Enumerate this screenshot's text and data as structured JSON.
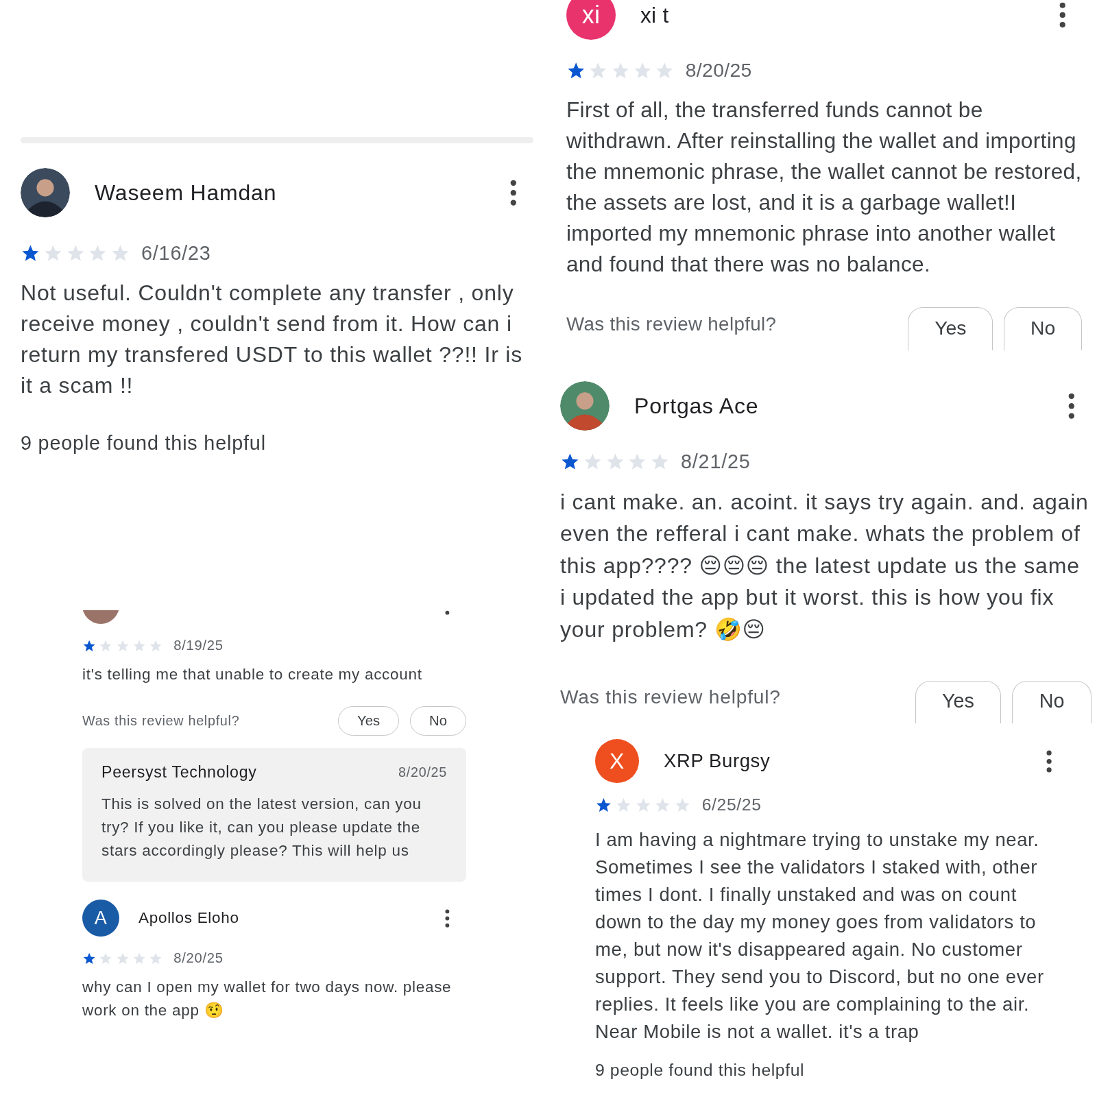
{
  "panels": [
    {
      "reviews": [
        {
          "avatar": {
            "kind": "photo"
          },
          "name": "Waseem Hamdan",
          "stars": 1,
          "date": "6/16/23",
          "text": "Not useful. Couldn't complete any transfer , only receive money , couldn't send from it. How can i return my transfered USDT to this wallet ??!! Ir is it a scam !!",
          "helpful_count": "9 people found this helpful"
        }
      ]
    },
    {
      "reviews": [
        {
          "avatar": {
            "kind": "letter",
            "letter": "xi",
            "color": "#e8336d"
          },
          "name": "xi t",
          "stars": 1,
          "date": "8/20/25",
          "text": "First of all, the transferred funds cannot be withdrawn. After reinstalling the wallet and importing the mnemonic phrase, the wallet cannot be restored, the assets are lost, and it is a garbage wallet!I imported my mnemonic phrase into another wallet and found that there was no balance.",
          "helpful_prompt": "Was this review helpful?",
          "buttons": [
            "Yes",
            "No"
          ]
        }
      ]
    },
    {
      "reviews": [
        {
          "avatar": {
            "kind": "photo"
          },
          "name": "Portgas Ace",
          "stars": 1,
          "date": "8/21/25",
          "text": "i cant make. an. acoint. it says try again. and. again even the refferal i cant make. whats the problem of this app???? 😔😔😔 the latest update us the same i updated the app but it worst. this is how you fix your problem? 🤣😔",
          "helpful_prompt": "Was this review helpful?",
          "buttons": [
            "Yes",
            "No"
          ]
        }
      ]
    },
    {
      "reviews": [
        {
          "avatar": {
            "kind": "plain",
            "color": "#9a7468"
          },
          "stars": 1,
          "date": "8/19/25",
          "text": "it's telling me that unable to create my account",
          "helpful_prompt": "Was this review helpful?",
          "buttons": [
            "Yes",
            "No"
          ],
          "reply": {
            "name": "Peersyst Technology",
            "date": "8/20/25",
            "text": "This is solved on the latest version, can you try? If you like it, can you please update the stars accordingly please? This will help us"
          }
        },
        {
          "avatar": {
            "kind": "letter",
            "letter": "A",
            "color": "#1a5ba6"
          },
          "name": "Apollos Eloho",
          "stars": 1,
          "date": "8/20/25",
          "text": "why can I open my wallet for two days now. please work on the app 🤨"
        }
      ]
    },
    {
      "reviews": [
        {
          "avatar": {
            "kind": "letter",
            "letter": "X",
            "color": "#ef4f1f"
          },
          "name": "XRP Burgsy",
          "stars": 1,
          "date": "6/25/25",
          "text": "I am having a nightmare trying to unstake my near. Sometimes I see the validators I staked with, other times I dont. I finally unstaked and was on count down to the day my money goes from validators to me, but now it's disappeared again. No customer support. They send you to Discord, but no one ever replies. It feels like you are complaining to the air. Near Mobile is not a wallet. it's a trap",
          "helpful_count": "9 people found this helpful"
        }
      ]
    }
  ]
}
